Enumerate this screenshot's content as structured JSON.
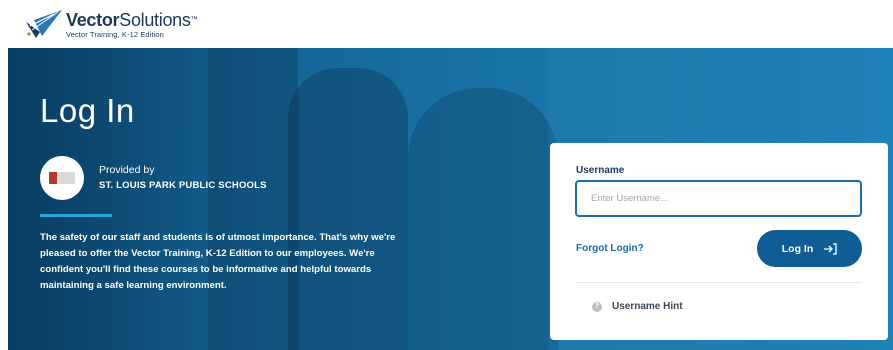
{
  "header": {
    "brand_bold": "Vector",
    "brand_regular": "Solutions",
    "brand_mark": "™",
    "edition": "Vector Training, K-12 Edition",
    "logo_icon": "vector-solutions-logo-icon"
  },
  "hero": {
    "title": "Log In",
    "provided_by": "Provided by",
    "organization": "ST. LOUIS PARK PUBLIC SCHOOLS",
    "organization_logo": "organization-logo",
    "description": "The safety of our staff and students is of utmost importance. That's why we're pleased to offer the Vector Training, K-12 Edition to our employees. We're confident you'll find these courses to be informative and helpful towards maintaining a safe learning environment."
  },
  "login_form": {
    "username_label": "Username",
    "username_placeholder": "Enter Username...",
    "username_value": "",
    "forgot_label": "Forgot Login?",
    "login_button": "Log In",
    "login_icon": "sign-in-arrow-icon",
    "hint_label": "Username Hint",
    "hint_icon": "help-circle-icon"
  },
  "colors": {
    "brand_navy": "#1b3a5c",
    "accent_blue": "#1a6fa8",
    "button_blue": "#0f5d94",
    "hero_blue": "#16689a",
    "accent_line": "#2aa3e0"
  }
}
